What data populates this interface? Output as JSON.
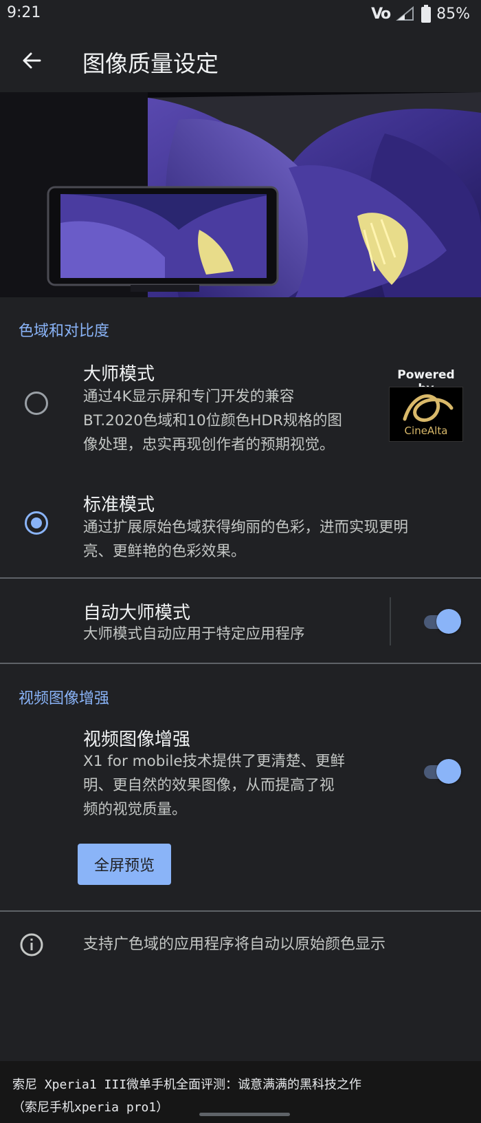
{
  "status_bar": {
    "time": "9:21",
    "network_label": "VoLTE",
    "battery": "85%"
  },
  "app_bar": {
    "title": "图像质量设定",
    "back_icon": "arrow-left-icon"
  },
  "color_section": {
    "header": "色域和对比度",
    "options": [
      {
        "title": "大师模式",
        "description_lines": [
          "通过4K显示屏和专门开发的兼容",
          "BT.2020色域和10位颜色HDR规格的图",
          "像处理，忠实再现创作者的预期视觉。"
        ],
        "selected": false
      },
      {
        "title": "标准模式",
        "description_lines": [
          "通过扩展原始色域获得绚丽的色彩，进而实现更明",
          "亮、更鲜艳的色彩效果。"
        ],
        "selected": true
      }
    ],
    "powered_by": "Powered by",
    "logo_text": "CineAlta"
  },
  "auto_master": {
    "title": "自动大师模式",
    "description": "大师模式自动应用于特定应用程序",
    "enabled": true
  },
  "video_section": {
    "header": "视频图像增强",
    "title": "视频图像增强",
    "description_lines": [
      "X1 for mobile技术提供了更清楚、更鲜",
      "明、更自然的效果图像，从而提高了视",
      "频的视觉质量。"
    ],
    "enabled": true,
    "preview_button": "全屏预览"
  },
  "info": {
    "icon": "info-icon",
    "text": "支持广色域的应用程序将自动以原始颜色显示"
  },
  "caption": {
    "line1": "索尼 Xperia1 III微单手机全面评测：诚意满满的黑科技之作",
    "line2": "（索尼手机xperia pro1）"
  },
  "colors": {
    "background": "#202124",
    "accent": "#8ab4f8",
    "text_primary": "#f1f3f4",
    "text_secondary": "#c4c7c5"
  }
}
